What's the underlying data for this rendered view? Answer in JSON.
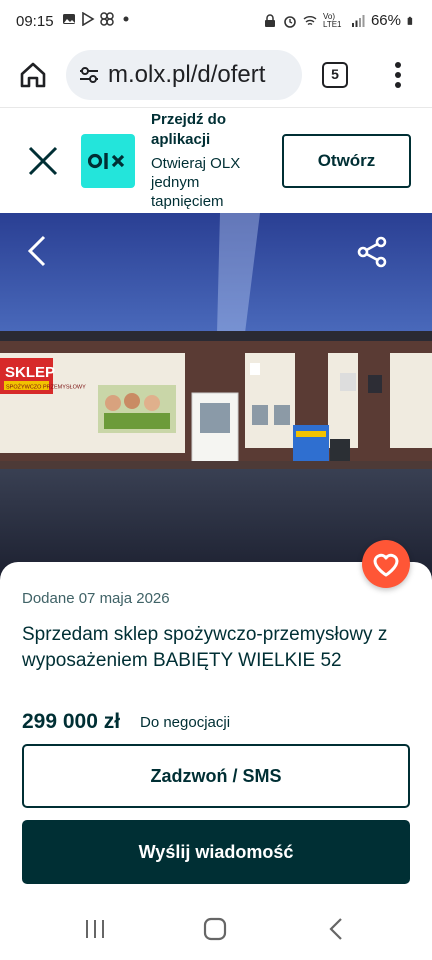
{
  "status_bar": {
    "time": "09:15",
    "battery": "66%",
    "network": "Vo) LTE1"
  },
  "browser": {
    "url": "m.olx.pl/d/ofert",
    "tab_count": "5"
  },
  "app_banner": {
    "logo_text": "OLX",
    "title": "Przejdź do aplikacji",
    "subtitle": "Otwieraj OLX jednym tapnięciem",
    "open_label": "Otwórz"
  },
  "photo": {
    "sign_text": "SKLEP",
    "sign_sub": "SPOŻYWCZO PRZEMYSŁOWY"
  },
  "listing": {
    "date": "Dodane 07 maja 2026",
    "title": "Sprzedam sklep spożywczo-przemysłowy z wyposażeniem BABIĘTY WIELKIE 52",
    "price": "299 000 zł",
    "negotiable": "Do negocjacji"
  },
  "actions": {
    "call_label": "Zadzwoń / SMS",
    "message_label": "Wyślij wiadomość"
  },
  "colors": {
    "olx_teal": "#23e5db",
    "olx_dark": "#002f34",
    "favorite": "#ff5636"
  }
}
